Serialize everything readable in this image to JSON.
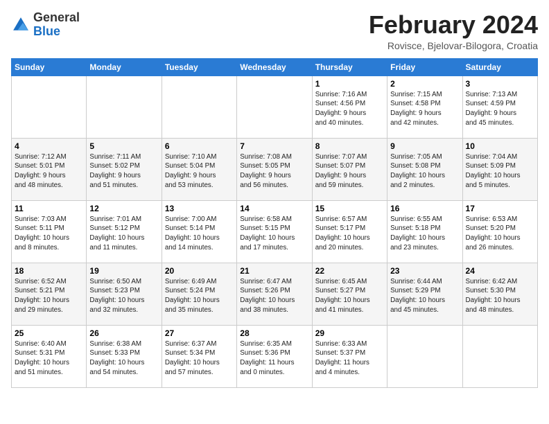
{
  "header": {
    "logo_general": "General",
    "logo_blue": "Blue",
    "month_year": "February 2024",
    "location": "Rovisce, Bjelovar-Bilogora, Croatia"
  },
  "calendar": {
    "weekdays": [
      "Sunday",
      "Monday",
      "Tuesday",
      "Wednesday",
      "Thursday",
      "Friday",
      "Saturday"
    ],
    "weeks": [
      [
        {
          "day": "",
          "detail": ""
        },
        {
          "day": "",
          "detail": ""
        },
        {
          "day": "",
          "detail": ""
        },
        {
          "day": "",
          "detail": ""
        },
        {
          "day": "1",
          "detail": "Sunrise: 7:16 AM\nSunset: 4:56 PM\nDaylight: 9 hours\nand 40 minutes."
        },
        {
          "day": "2",
          "detail": "Sunrise: 7:15 AM\nSunset: 4:58 PM\nDaylight: 9 hours\nand 42 minutes."
        },
        {
          "day": "3",
          "detail": "Sunrise: 7:13 AM\nSunset: 4:59 PM\nDaylight: 9 hours\nand 45 minutes."
        }
      ],
      [
        {
          "day": "4",
          "detail": "Sunrise: 7:12 AM\nSunset: 5:01 PM\nDaylight: 9 hours\nand 48 minutes."
        },
        {
          "day": "5",
          "detail": "Sunrise: 7:11 AM\nSunset: 5:02 PM\nDaylight: 9 hours\nand 51 minutes."
        },
        {
          "day": "6",
          "detail": "Sunrise: 7:10 AM\nSunset: 5:04 PM\nDaylight: 9 hours\nand 53 minutes."
        },
        {
          "day": "7",
          "detail": "Sunrise: 7:08 AM\nSunset: 5:05 PM\nDaylight: 9 hours\nand 56 minutes."
        },
        {
          "day": "8",
          "detail": "Sunrise: 7:07 AM\nSunset: 5:07 PM\nDaylight: 9 hours\nand 59 minutes."
        },
        {
          "day": "9",
          "detail": "Sunrise: 7:05 AM\nSunset: 5:08 PM\nDaylight: 10 hours\nand 2 minutes."
        },
        {
          "day": "10",
          "detail": "Sunrise: 7:04 AM\nSunset: 5:09 PM\nDaylight: 10 hours\nand 5 minutes."
        }
      ],
      [
        {
          "day": "11",
          "detail": "Sunrise: 7:03 AM\nSunset: 5:11 PM\nDaylight: 10 hours\nand 8 minutes."
        },
        {
          "day": "12",
          "detail": "Sunrise: 7:01 AM\nSunset: 5:12 PM\nDaylight: 10 hours\nand 11 minutes."
        },
        {
          "day": "13",
          "detail": "Sunrise: 7:00 AM\nSunset: 5:14 PM\nDaylight: 10 hours\nand 14 minutes."
        },
        {
          "day": "14",
          "detail": "Sunrise: 6:58 AM\nSunset: 5:15 PM\nDaylight: 10 hours\nand 17 minutes."
        },
        {
          "day": "15",
          "detail": "Sunrise: 6:57 AM\nSunset: 5:17 PM\nDaylight: 10 hours\nand 20 minutes."
        },
        {
          "day": "16",
          "detail": "Sunrise: 6:55 AM\nSunset: 5:18 PM\nDaylight: 10 hours\nand 23 minutes."
        },
        {
          "day": "17",
          "detail": "Sunrise: 6:53 AM\nSunset: 5:20 PM\nDaylight: 10 hours\nand 26 minutes."
        }
      ],
      [
        {
          "day": "18",
          "detail": "Sunrise: 6:52 AM\nSunset: 5:21 PM\nDaylight: 10 hours\nand 29 minutes."
        },
        {
          "day": "19",
          "detail": "Sunrise: 6:50 AM\nSunset: 5:23 PM\nDaylight: 10 hours\nand 32 minutes."
        },
        {
          "day": "20",
          "detail": "Sunrise: 6:49 AM\nSunset: 5:24 PM\nDaylight: 10 hours\nand 35 minutes."
        },
        {
          "day": "21",
          "detail": "Sunrise: 6:47 AM\nSunset: 5:26 PM\nDaylight: 10 hours\nand 38 minutes."
        },
        {
          "day": "22",
          "detail": "Sunrise: 6:45 AM\nSunset: 5:27 PM\nDaylight: 10 hours\nand 41 minutes."
        },
        {
          "day": "23",
          "detail": "Sunrise: 6:44 AM\nSunset: 5:29 PM\nDaylight: 10 hours\nand 45 minutes."
        },
        {
          "day": "24",
          "detail": "Sunrise: 6:42 AM\nSunset: 5:30 PM\nDaylight: 10 hours\nand 48 minutes."
        }
      ],
      [
        {
          "day": "25",
          "detail": "Sunrise: 6:40 AM\nSunset: 5:31 PM\nDaylight: 10 hours\nand 51 minutes."
        },
        {
          "day": "26",
          "detail": "Sunrise: 6:38 AM\nSunset: 5:33 PM\nDaylight: 10 hours\nand 54 minutes."
        },
        {
          "day": "27",
          "detail": "Sunrise: 6:37 AM\nSunset: 5:34 PM\nDaylight: 10 hours\nand 57 minutes."
        },
        {
          "day": "28",
          "detail": "Sunrise: 6:35 AM\nSunset: 5:36 PM\nDaylight: 11 hours\nand 0 minutes."
        },
        {
          "day": "29",
          "detail": "Sunrise: 6:33 AM\nSunset: 5:37 PM\nDaylight: 11 hours\nand 4 minutes."
        },
        {
          "day": "",
          "detail": ""
        },
        {
          "day": "",
          "detail": ""
        }
      ]
    ]
  }
}
